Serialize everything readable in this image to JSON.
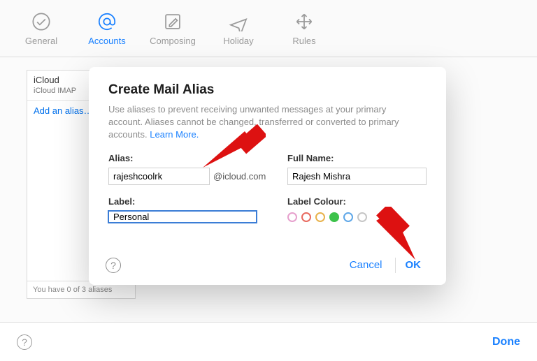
{
  "toolbar": {
    "items": [
      {
        "label": "General",
        "icon": "check-circle"
      },
      {
        "label": "Accounts",
        "icon": "at-sign"
      },
      {
        "label": "Composing",
        "icon": "compose"
      },
      {
        "label": "Holiday",
        "icon": "airplane"
      },
      {
        "label": "Rules",
        "icon": "arrows-move"
      }
    ],
    "active_index": 1
  },
  "sidebar": {
    "account_name": "iCloud",
    "account_detail": "iCloud IMAP",
    "add_link": "Add an alias…",
    "footer": "You have 0 of 3 aliases"
  },
  "modal": {
    "title": "Create Mail Alias",
    "description": "Use aliases to prevent receiving unwanted messages at your primary account. Aliases cannot be changed, transferred or converted to primary accounts. ",
    "learn_more": "Learn More.",
    "alias_label": "Alias:",
    "alias_value": "rajeshcoolrk",
    "alias_domain": "@icloud.com",
    "name_label": "Full Name:",
    "name_value": "Rajesh Mishra",
    "label_label": "Label:",
    "label_value": "Personal",
    "color_label": "Label Colour:",
    "colors": [
      "#e6a0cd",
      "#e86a5f",
      "#e8b24b",
      "#3cc24a",
      "#5fa7e8",
      "#c6c6c6"
    ],
    "selected_color_index": 3,
    "help_symbol": "?",
    "cancel": "Cancel",
    "ok": "OK"
  },
  "bottom": {
    "help_symbol": "?",
    "done": "Done"
  }
}
